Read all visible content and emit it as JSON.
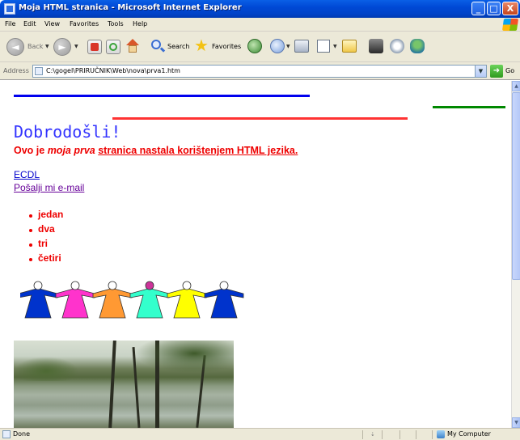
{
  "window": {
    "title": "Moja HTML stranica - Microsoft Internet Explorer",
    "min_glyph": "_",
    "max_glyph": "□",
    "close_glyph": "X"
  },
  "menu": {
    "items": [
      "File",
      "Edit",
      "View",
      "Favorites",
      "Tools",
      "Help"
    ]
  },
  "toolbar": {
    "back_label": "Back",
    "search_label": "Search",
    "favorites_label": "Favorites"
  },
  "address": {
    "label": "Address",
    "value": "C:\\gogel\\PRIRUČNIK\\Web\\nova\\prva1.htm",
    "go_label": "Go"
  },
  "page": {
    "welcome": "Dobrodošli!",
    "intro": {
      "prefix": "Ovo je ",
      "emphasis": "moja prva",
      "suffix_underlined": "stranica nastala korištenjem HTML jezika."
    },
    "links": {
      "ecdl": "ECDL",
      "email": "Pošalji mi e-mail"
    },
    "list": [
      "jedan",
      "dva",
      "tri",
      "četiri"
    ],
    "figure_colors": [
      "#0033cc",
      "#ff33cc",
      "#ff9933",
      "#33ffcc",
      "#ffff00",
      "#0033cc"
    ],
    "colors": {
      "hr_blue": "#0000ee",
      "hr_red": "#ff3333",
      "hr_green": "#008800",
      "welcome": "#3333ff",
      "text_red": "#ee0000"
    }
  },
  "status": {
    "text": "Done",
    "zone": "My Computer"
  }
}
